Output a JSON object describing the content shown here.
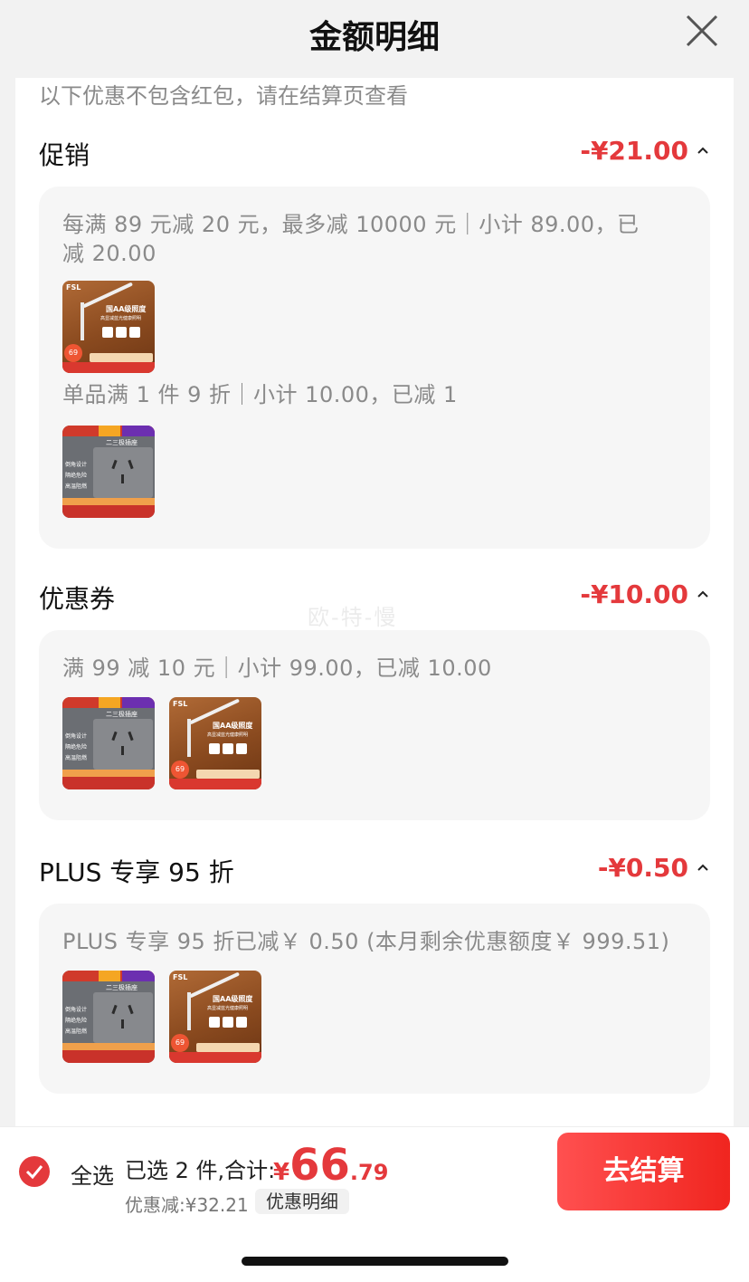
{
  "header": {
    "title": "金额明细"
  },
  "notice": "以下优惠不包含红包，请在结算页查看",
  "sections": [
    {
      "title": "促销",
      "amount": "-¥21.00",
      "rules": [
        {
          "text": "每满 89 元减 20 元，最多减 10000 元｜小计 89.00，已减 20.00"
        },
        {
          "text": "单品满 1 件 9 折｜小计 10.00，已减 1"
        }
      ]
    },
    {
      "title": "优惠券",
      "amount": "-¥10.00",
      "rules": [
        {
          "text": "满 99 减 10 元｜小计 99.00，已减 10.00"
        }
      ]
    },
    {
      "title": "PLUS 专享 95 折",
      "amount": "-¥0.50",
      "rules": [
        {
          "text": "PLUS 专享 95 折已减￥ 0.50 (本月剩余优惠额度￥ 999.51)"
        }
      ]
    }
  ],
  "products": {
    "lamp": {
      "brand": "FSL",
      "tag": "国AA级照度",
      "sub": "高显减蓝光健康照明",
      "badge": "69"
    },
    "socket": {
      "brand": "FSL 佛山照明",
      "label": "二三极插座",
      "f1": "倒角设计",
      "f2": "隔绝危险",
      "f3": "高温阻燃"
    }
  },
  "watermark": "欧-特-慢",
  "bottom": {
    "select_all": "全选",
    "selected": "已选 2 件,合计:",
    "currency": "¥",
    "total_int": "66",
    "total_dec": ".79",
    "discount": "优惠减:¥32.21",
    "detail": "优惠明细",
    "checkout": "去结算"
  },
  "colors": {
    "accent": "#e4393c",
    "checkout_bg": "#f0251f"
  }
}
